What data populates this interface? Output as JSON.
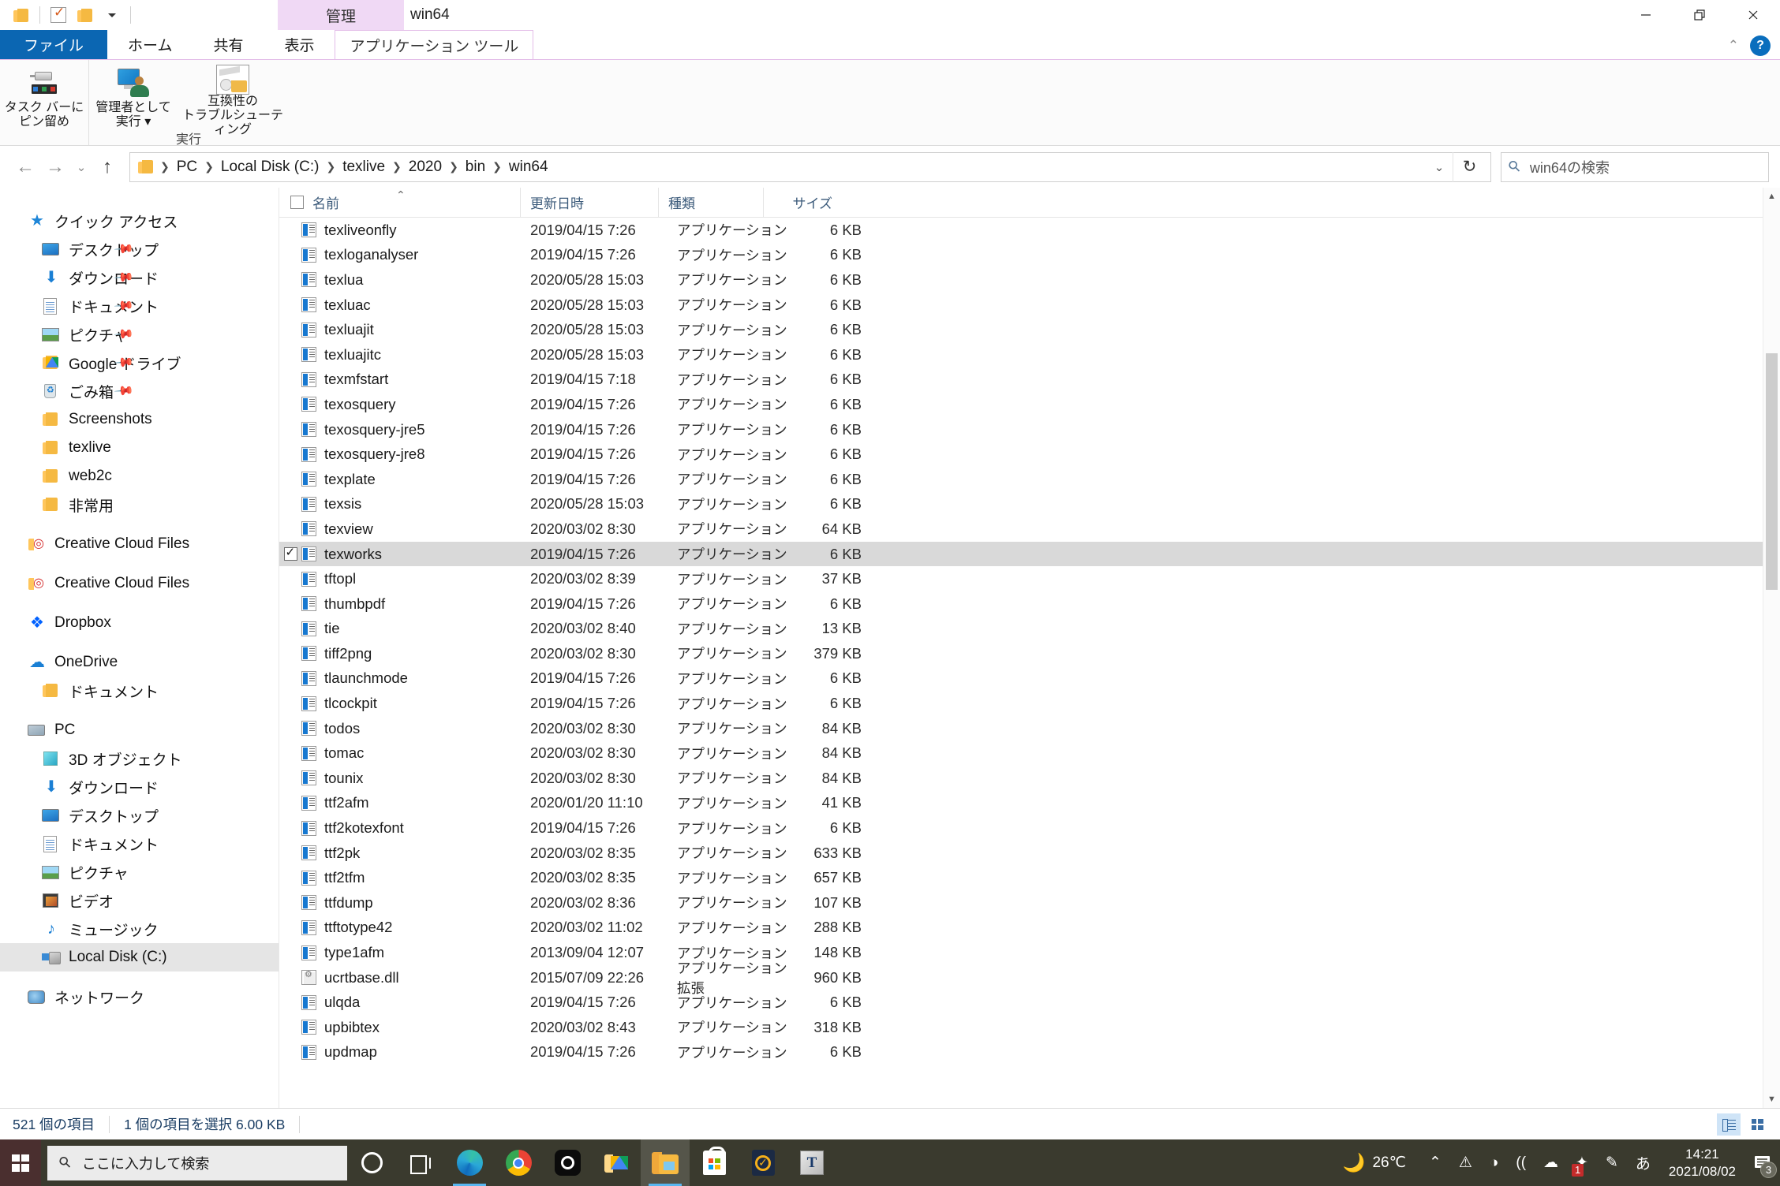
{
  "window": {
    "title": "win64",
    "contextual_tab_group": "管理",
    "minimize": "—",
    "maximize": "❐",
    "close": "✕"
  },
  "quick_access_toolbar": {
    "folder_label": "",
    "properties_label": "",
    "new_folder_label": "",
    "dropdown_label": ""
  },
  "ribbon": {
    "tabs": [
      {
        "label": "ファイル",
        "id": "file"
      },
      {
        "label": "ホーム",
        "id": "home"
      },
      {
        "label": "共有",
        "id": "share"
      },
      {
        "label": "表示",
        "id": "view"
      },
      {
        "label": "アプリケーション ツール",
        "id": "app-tools"
      }
    ],
    "collapse_label": "⌃",
    "help_label": "?",
    "groups": [
      {
        "title": "",
        "buttons": [
          {
            "label_line1": "タスク バーに",
            "label_line2": "ピン留め",
            "icon": "pin-icon"
          }
        ]
      },
      {
        "title": "実行",
        "buttons": [
          {
            "label_line1": "管理者として",
            "label_line2": "実行 ▾",
            "icon": "admin-run-icon"
          },
          {
            "label_line1": "互換性の",
            "label_line2": "トラブルシューティング",
            "icon": "compatibility-icon"
          }
        ]
      }
    ]
  },
  "address_bar": {
    "back": "←",
    "forward": "→",
    "recent": "⌄",
    "up": "↑",
    "breadcrumbs": [
      "PC",
      "Local Disk (C:)",
      "texlive",
      "2020",
      "bin",
      "win64"
    ],
    "separator": "❯",
    "dropdown": "⌄",
    "refresh": "↻",
    "search_placeholder": "win64の検索"
  },
  "navigation_pane": {
    "items": [
      {
        "label": "クイック アクセス",
        "icon": "star-icon",
        "indent": 0,
        "pinned": false,
        "selected": false
      },
      {
        "label": "デスクトップ",
        "icon": "desktop-icon",
        "indent": 1,
        "pinned": true,
        "selected": false
      },
      {
        "label": "ダウンロード",
        "icon": "download-icon",
        "indent": 1,
        "pinned": true,
        "selected": false
      },
      {
        "label": "ドキュメント",
        "icon": "documents-icon",
        "indent": 1,
        "pinned": true,
        "selected": false
      },
      {
        "label": "ピクチャ",
        "icon": "pictures-icon",
        "indent": 1,
        "pinned": true,
        "selected": false
      },
      {
        "label": "Google ドライブ",
        "icon": "google-drive-icon",
        "indent": 1,
        "pinned": true,
        "selected": false
      },
      {
        "label": "ごみ箱",
        "icon": "recycle-bin-icon",
        "indent": 1,
        "pinned": true,
        "selected": false
      },
      {
        "label": "Screenshots",
        "icon": "folder-icon",
        "indent": 1,
        "pinned": false,
        "selected": false
      },
      {
        "label": "texlive",
        "icon": "folder-icon",
        "indent": 1,
        "pinned": false,
        "selected": false
      },
      {
        "label": "web2c",
        "icon": "folder-icon",
        "indent": 1,
        "pinned": false,
        "selected": false
      },
      {
        "label": "非常用",
        "icon": "folder-icon",
        "indent": 1,
        "pinned": false,
        "selected": false
      },
      {
        "label": "Creative Cloud Files",
        "icon": "creative-cloud-icon",
        "indent": 0,
        "pinned": false,
        "selected": false,
        "gap_before": true
      },
      {
        "label": "Creative Cloud Files",
        "icon": "creative-cloud-icon",
        "indent": 0,
        "pinned": false,
        "selected": false,
        "gap_before": true
      },
      {
        "label": "Dropbox",
        "icon": "dropbox-icon",
        "indent": 0,
        "pinned": false,
        "selected": false,
        "gap_before": true
      },
      {
        "label": "OneDrive",
        "icon": "onedrive-icon",
        "indent": 0,
        "pinned": false,
        "selected": false,
        "gap_before": true
      },
      {
        "label": "ドキュメント",
        "icon": "folder-icon",
        "indent": 1,
        "pinned": false,
        "selected": false
      },
      {
        "label": "PC",
        "icon": "pc-icon",
        "indent": 0,
        "pinned": false,
        "selected": false,
        "gap_before": true
      },
      {
        "label": "3D オブジェクト",
        "icon": "3d-objects-icon",
        "indent": 1,
        "pinned": false,
        "selected": false
      },
      {
        "label": "ダウンロード",
        "icon": "download-icon",
        "indent": 1,
        "pinned": false,
        "selected": false
      },
      {
        "label": "デスクトップ",
        "icon": "desktop-icon",
        "indent": 1,
        "pinned": false,
        "selected": false
      },
      {
        "label": "ドキュメント",
        "icon": "documents-icon",
        "indent": 1,
        "pinned": false,
        "selected": false
      },
      {
        "label": "ピクチャ",
        "icon": "pictures-icon",
        "indent": 1,
        "pinned": false,
        "selected": false
      },
      {
        "label": "ビデオ",
        "icon": "videos-icon",
        "indent": 1,
        "pinned": false,
        "selected": false
      },
      {
        "label": "ミュージック",
        "icon": "music-icon",
        "indent": 1,
        "pinned": false,
        "selected": false
      },
      {
        "label": "Local Disk (C:)",
        "icon": "local-disk-icon",
        "indent": 1,
        "pinned": false,
        "selected": true
      },
      {
        "label": "ネットワーク",
        "icon": "network-icon",
        "indent": 0,
        "pinned": false,
        "selected": false,
        "gap_before": true
      }
    ]
  },
  "file_list": {
    "columns": [
      {
        "label": "名前",
        "key": "name",
        "sorted": true,
        "sort_dir": "asc"
      },
      {
        "label": "更新日時",
        "key": "date"
      },
      {
        "label": "種類",
        "key": "type"
      },
      {
        "label": "サイズ",
        "key": "size"
      }
    ],
    "rows": [
      {
        "name": "texliveonfly",
        "date": "2019/04/15 7:26",
        "type": "アプリケーション",
        "size": "6 KB",
        "icon": "application-icon",
        "selected": false
      },
      {
        "name": "texloganalyser",
        "date": "2019/04/15 7:26",
        "type": "アプリケーション",
        "size": "6 KB",
        "icon": "application-icon",
        "selected": false
      },
      {
        "name": "texlua",
        "date": "2020/05/28 15:03",
        "type": "アプリケーション",
        "size": "6 KB",
        "icon": "application-icon",
        "selected": false
      },
      {
        "name": "texluac",
        "date": "2020/05/28 15:03",
        "type": "アプリケーション",
        "size": "6 KB",
        "icon": "application-icon",
        "selected": false
      },
      {
        "name": "texluajit",
        "date": "2020/05/28 15:03",
        "type": "アプリケーション",
        "size": "6 KB",
        "icon": "application-icon",
        "selected": false
      },
      {
        "name": "texluajitc",
        "date": "2020/05/28 15:03",
        "type": "アプリケーション",
        "size": "6 KB",
        "icon": "application-icon",
        "selected": false
      },
      {
        "name": "texmfstart",
        "date": "2019/04/15 7:18",
        "type": "アプリケーション",
        "size": "6 KB",
        "icon": "application-icon",
        "selected": false
      },
      {
        "name": "texosquery",
        "date": "2019/04/15 7:26",
        "type": "アプリケーション",
        "size": "6 KB",
        "icon": "application-icon",
        "selected": false
      },
      {
        "name": "texosquery-jre5",
        "date": "2019/04/15 7:26",
        "type": "アプリケーション",
        "size": "6 KB",
        "icon": "application-icon",
        "selected": false
      },
      {
        "name": "texosquery-jre8",
        "date": "2019/04/15 7:26",
        "type": "アプリケーション",
        "size": "6 KB",
        "icon": "application-icon",
        "selected": false
      },
      {
        "name": "texplate",
        "date": "2019/04/15 7:26",
        "type": "アプリケーション",
        "size": "6 KB",
        "icon": "application-icon",
        "selected": false
      },
      {
        "name": "texsis",
        "date": "2020/05/28 15:03",
        "type": "アプリケーション",
        "size": "6 KB",
        "icon": "application-icon",
        "selected": false
      },
      {
        "name": "texview",
        "date": "2020/03/02 8:30",
        "type": "アプリケーション",
        "size": "64 KB",
        "icon": "application-icon",
        "selected": false
      },
      {
        "name": "texworks",
        "date": "2019/04/15 7:26",
        "type": "アプリケーション",
        "size": "6 KB",
        "icon": "application-icon",
        "selected": true
      },
      {
        "name": "tftopl",
        "date": "2020/03/02 8:39",
        "type": "アプリケーション",
        "size": "37 KB",
        "icon": "application-icon",
        "selected": false
      },
      {
        "name": "thumbpdf",
        "date": "2019/04/15 7:26",
        "type": "アプリケーション",
        "size": "6 KB",
        "icon": "application-icon",
        "selected": false
      },
      {
        "name": "tie",
        "date": "2020/03/02 8:40",
        "type": "アプリケーション",
        "size": "13 KB",
        "icon": "application-icon",
        "selected": false
      },
      {
        "name": "tiff2png",
        "date": "2020/03/02 8:30",
        "type": "アプリケーション",
        "size": "379 KB",
        "icon": "application-icon",
        "selected": false
      },
      {
        "name": "tlaunchmode",
        "date": "2019/04/15 7:26",
        "type": "アプリケーション",
        "size": "6 KB",
        "icon": "application-icon",
        "selected": false
      },
      {
        "name": "tlcockpit",
        "date": "2019/04/15 7:26",
        "type": "アプリケーション",
        "size": "6 KB",
        "icon": "application-icon",
        "selected": false
      },
      {
        "name": "todos",
        "date": "2020/03/02 8:30",
        "type": "アプリケーション",
        "size": "84 KB",
        "icon": "application-icon",
        "selected": false
      },
      {
        "name": "tomac",
        "date": "2020/03/02 8:30",
        "type": "アプリケーション",
        "size": "84 KB",
        "icon": "application-icon",
        "selected": false
      },
      {
        "name": "tounix",
        "date": "2020/03/02 8:30",
        "type": "アプリケーション",
        "size": "84 KB",
        "icon": "application-icon",
        "selected": false
      },
      {
        "name": "ttf2afm",
        "date": "2020/01/20 11:10",
        "type": "アプリケーション",
        "size": "41 KB",
        "icon": "application-icon",
        "selected": false
      },
      {
        "name": "ttf2kotexfont",
        "date": "2019/04/15 7:26",
        "type": "アプリケーション",
        "size": "6 KB",
        "icon": "application-icon",
        "selected": false
      },
      {
        "name": "ttf2pk",
        "date": "2020/03/02 8:35",
        "type": "アプリケーション",
        "size": "633 KB",
        "icon": "application-icon",
        "selected": false
      },
      {
        "name": "ttf2tfm",
        "date": "2020/03/02 8:35",
        "type": "アプリケーション",
        "size": "657 KB",
        "icon": "application-icon",
        "selected": false
      },
      {
        "name": "ttfdump",
        "date": "2020/03/02 8:36",
        "type": "アプリケーション",
        "size": "107 KB",
        "icon": "application-icon",
        "selected": false
      },
      {
        "name": "ttftotype42",
        "date": "2020/03/02 11:02",
        "type": "アプリケーション",
        "size": "288 KB",
        "icon": "application-icon",
        "selected": false
      },
      {
        "name": "type1afm",
        "date": "2013/09/04 12:07",
        "type": "アプリケーション",
        "size": "148 KB",
        "icon": "application-icon",
        "selected": false
      },
      {
        "name": "ucrtbase.dll",
        "date": "2015/07/09 22:26",
        "type": "アプリケーション拡張",
        "size": "960 KB",
        "icon": "dll-icon",
        "selected": false
      },
      {
        "name": "ulqda",
        "date": "2019/04/15 7:26",
        "type": "アプリケーション",
        "size": "6 KB",
        "icon": "application-icon",
        "selected": false
      },
      {
        "name": "upbibtex",
        "date": "2020/03/02 8:43",
        "type": "アプリケーション",
        "size": "318 KB",
        "icon": "application-icon",
        "selected": false
      },
      {
        "name": "updmap",
        "date": "2019/04/15 7:26",
        "type": "アプリケーション",
        "size": "6 KB",
        "icon": "application-icon",
        "selected": false
      }
    ]
  },
  "status_bar": {
    "item_count": "521 個の項目",
    "selection_info": "1 個の項目を選択  6.00 KB",
    "view_details_label": "",
    "view_large_icons_label": ""
  },
  "taskbar": {
    "start_label": "",
    "search_placeholder": "ここに入力して検索",
    "buttons": [
      {
        "name": "cortana-button",
        "icon": "cortana-icon"
      },
      {
        "name": "task-view-button",
        "icon": "task-view-icon"
      },
      {
        "name": "edge-button",
        "icon": "edge-icon",
        "running": true
      },
      {
        "name": "chrome-button",
        "icon": "chrome-icon",
        "running": false
      },
      {
        "name": "cortana-app-button",
        "icon": "cortana-app-icon",
        "running": false
      },
      {
        "name": "google-drive-button",
        "icon": "google-drive-folder-icon",
        "running": false
      },
      {
        "name": "file-explorer-button",
        "icon": "file-explorer-icon",
        "running": true,
        "active": true
      },
      {
        "name": "microsoft-store-button",
        "icon": "store-icon",
        "running": false
      },
      {
        "name": "norton-button",
        "icon": "norton-icon",
        "running": false
      },
      {
        "name": "texworks-button",
        "icon": "texworks-icon",
        "running": false
      }
    ],
    "tray": {
      "weather_temp": "26℃",
      "weather_icon": "moon-cloud-icon",
      "show_hidden": "⌃",
      "icons": [
        {
          "name": "display-warning-icon",
          "glyph": "⚠",
          "badge": ""
        },
        {
          "name": "volume-icon",
          "glyph": "◑",
          "badge": ""
        },
        {
          "name": "wifi-icon",
          "glyph": "((",
          "badge": ""
        },
        {
          "name": "onedrive-tray-icon",
          "glyph": "☁",
          "badge": ""
        },
        {
          "name": "creative-cloud-tray-icon",
          "glyph": "✦",
          "badge": "1"
        },
        {
          "name": "pen-icon",
          "glyph": "✎",
          "badge": ""
        },
        {
          "name": "ime-icon",
          "glyph": "あ",
          "badge": ""
        }
      ],
      "clock_time": "14:21",
      "clock_date": "2021/08/02",
      "notification_count": "3"
    }
  }
}
